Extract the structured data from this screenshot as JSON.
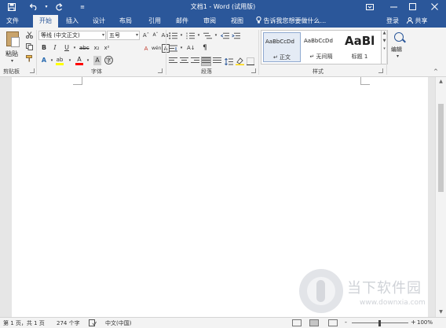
{
  "window": {
    "title": "文档1 - Word (试用版)",
    "quick_access": {
      "save_icon": "save-icon",
      "undo_icon": "undo-icon",
      "redo_icon": "redo-icon",
      "customize_icon": "customize-icon"
    },
    "controls": {
      "ribbon_options_icon": "ribbon-display-options-icon",
      "minimize_icon": "minimize-icon",
      "maximize_icon": "maximize-icon",
      "close_icon": "close-icon"
    }
  },
  "ribbon_tabs": [
    {
      "label": "文件",
      "active": false
    },
    {
      "label": "开始",
      "active": true
    },
    {
      "label": "插入",
      "active": false
    },
    {
      "label": "设计",
      "active": false
    },
    {
      "label": "布局",
      "active": false
    },
    {
      "label": "引用",
      "active": false
    },
    {
      "label": "邮件",
      "active": false
    },
    {
      "label": "审阅",
      "active": false
    },
    {
      "label": "视图",
      "active": false
    }
  ],
  "tell_me": {
    "placeholder": "告诉我您想要做什么...",
    "icon": "lightbulb-icon"
  },
  "account": {
    "login_label": "登录",
    "share_label": "共享",
    "share_icon": "person-icon"
  },
  "clipboard": {
    "paste_label": "粘贴",
    "group_label": "剪贴板",
    "cut_icon": "scissors-icon",
    "copy_icon": "copy-icon",
    "format_painter_icon": "format-painter-icon"
  },
  "font": {
    "group_label": "字体",
    "font_name": "等线 (中文正文)",
    "font_size": "五号",
    "grow_label": "Aˆ",
    "shrink_label": "Aˇ",
    "case_label": "Aa",
    "clear_label": "A",
    "wen_label": "wén",
    "border_char_label": "A",
    "bold_label": "B",
    "italic_label": "I",
    "underline_label": "U",
    "strike_label": "abc",
    "subscript_label": "x₂",
    "superscript_label": "x²",
    "effects_label": "A",
    "highlight_label": "ab",
    "font_color_label": "A",
    "char_shading_label": "A",
    "enclose_label": "字",
    "highlight_color": "#ffff00",
    "font_color": "#ff0000"
  },
  "paragraph": {
    "group_label": "段落",
    "sort_label": "A↓",
    "marks_label": "¶"
  },
  "styles": {
    "group_label": "样式",
    "items": [
      {
        "sample": "AaBbCcDd",
        "name": "↵ 正文",
        "selected": true
      },
      {
        "sample": "AaBbCcDd",
        "name": "↵ 无间隔",
        "selected": false
      },
      {
        "sample": "AaBl",
        "name": "标题 1",
        "selected": false
      }
    ]
  },
  "editing": {
    "label": "编辑",
    "icon": "search-icon"
  },
  "status": {
    "page": "第 1 页，共 1 页",
    "words": "274 个字",
    "language": "中文(中国)",
    "zoom": "100%",
    "zoom_minus": "-",
    "zoom_plus": "+",
    "zoom_level": 1.0
  },
  "watermark": {
    "site_name": "当下软件园",
    "url": "www.downxia.com"
  },
  "colors": {
    "accent": "#2b579a",
    "ribbon_bg": "#f3f3f3",
    "doc_bg": "#e6e6e6"
  }
}
